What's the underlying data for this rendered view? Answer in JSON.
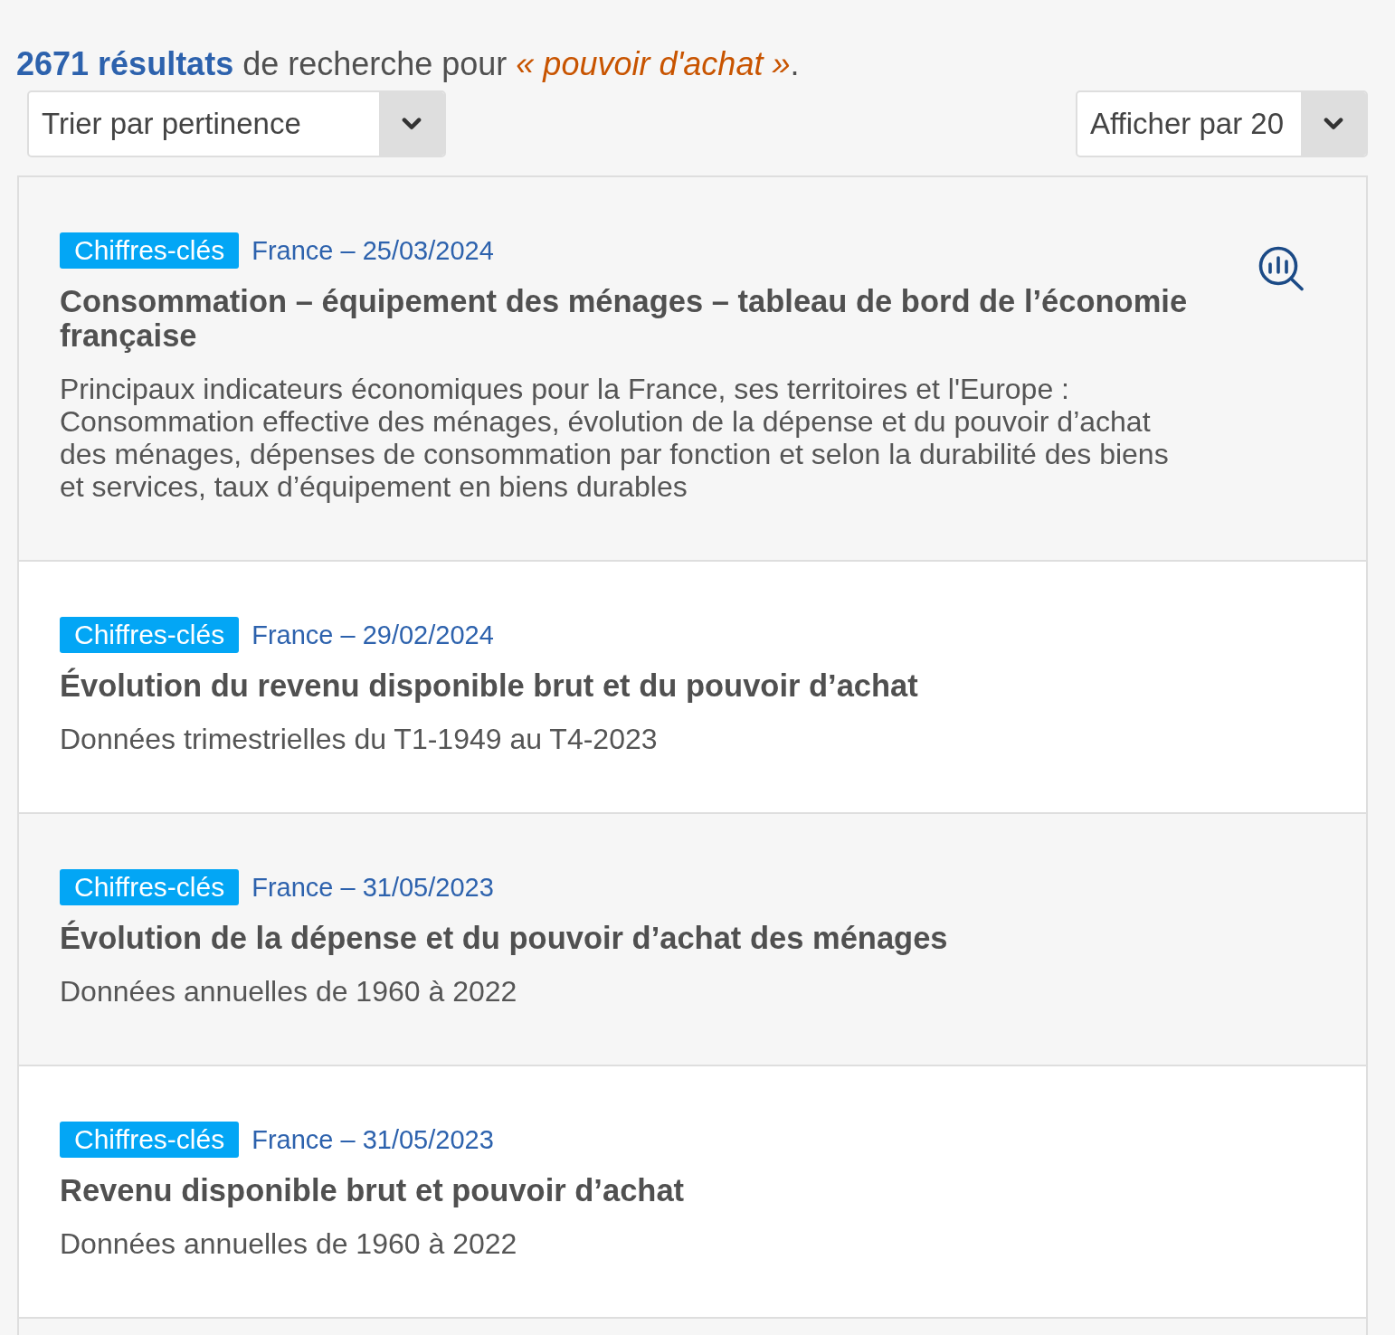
{
  "summary": "**2671 résultats** de recherche pour *« pouvoir d'achat »*.",
  "sort": {
    "value": "Trier par pertinence"
  },
  "page_size": {
    "value": "Afficher par 20"
  },
  "results": [
    {
      "badge": "Chiffres-clés",
      "meta": "France – 25/03/2024",
      "title": "Consommation – équipement des ménages – tableau de bord de l’économie française",
      "description": "Principaux indicateurs économiques pour la France, ses territoires et l'Europe : Consommation effective des ménages, évolution de la dépense et du pouvoir d’achat des ménages, dépenses de consommation par fonction et selon la durabilité des biens et services, taux d’équipement en biens durables",
      "chart_icon": true
    },
    {
      "badge": "Chiffres-clés",
      "meta": "France – 29/02/2024",
      "title": "Évolution du revenu disponible brut et du pouvoir d’achat",
      "description": "Données trimestrielles du T1-1949 au T4-2023",
      "chart_icon": false
    },
    {
      "badge": "Chiffres-clés",
      "meta": "France – 31/05/2023",
      "title": "Évolution de la dépense et du pouvoir d’achat des ménages",
      "description": "Données annuelles de 1960 à 2022",
      "chart_icon": false
    },
    {
      "badge": "Chiffres-clés",
      "meta": "France – 31/05/2023",
      "title": "Revenu disponible brut et pouvoir d’achat",
      "description": "Données annuelles de 1960 à 2022",
      "chart_icon": false
    }
  ]
}
